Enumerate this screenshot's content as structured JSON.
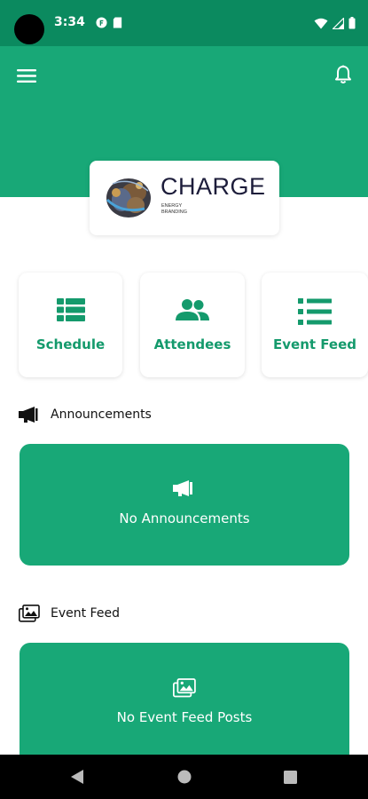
{
  "status_bar": {
    "time": "3:34",
    "icons": [
      "camera-cutout",
      "app-notification-icon",
      "sd-card-icon",
      "wifi-icon",
      "signal-icon",
      "battery-icon"
    ]
  },
  "header": {
    "menu_icon": "hamburger-menu-icon",
    "notification_icon": "bell-icon",
    "color": "#18a877"
  },
  "logo": {
    "title": "CHARGE",
    "subtitle_line1": "ENERGY",
    "subtitle_line2": "BRANDING"
  },
  "quick_actions": [
    {
      "label": "Schedule",
      "icon": "schedule-list-icon"
    },
    {
      "label": "Attendees",
      "icon": "people-icon"
    },
    {
      "label": "Event Feed",
      "icon": "feed-list-icon"
    }
  ],
  "announcements": {
    "heading": "Announcements",
    "icon": "megaphone-icon",
    "empty_text": "No Announcements"
  },
  "event_feed": {
    "heading": "Event Feed",
    "icon": "photo-gallery-icon",
    "empty_text": "No Event Feed Posts"
  },
  "nav_bar": {
    "buttons": [
      "back-icon",
      "home-icon",
      "recents-icon"
    ]
  },
  "colors": {
    "accent": "#18a877",
    "accent_dark": "#0b8a5f",
    "accent_text": "#149a6c"
  }
}
